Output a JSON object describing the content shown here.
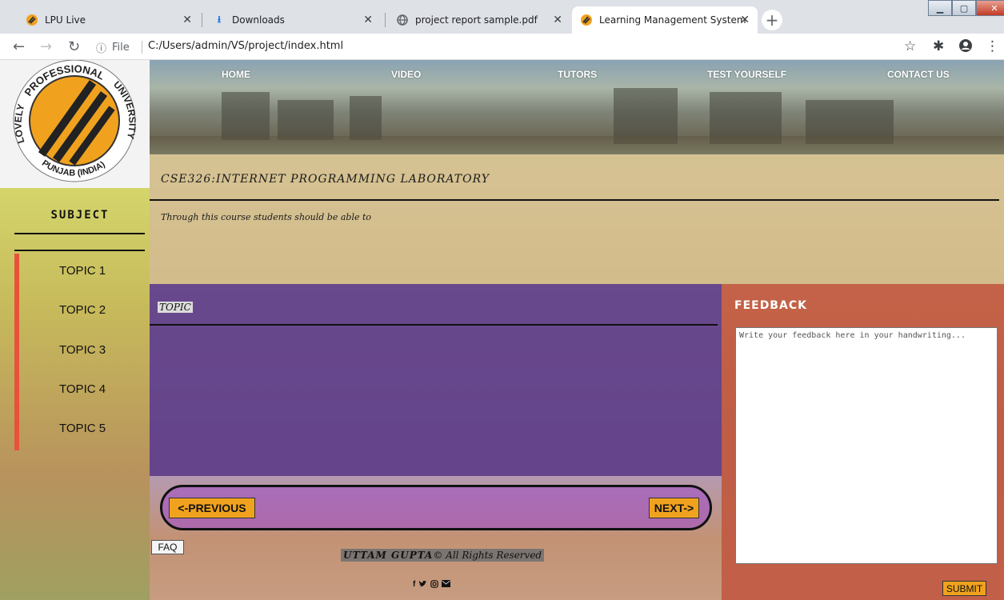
{
  "browser": {
    "tabs": [
      {
        "title": "LPU Live",
        "icon": "lpu-logo-icon"
      },
      {
        "title": "Downloads",
        "icon": "download-icon"
      },
      {
        "title": "project report sample.pdf",
        "icon": "globe-icon"
      },
      {
        "title": "Learning Management System",
        "icon": "lpu-logo-icon",
        "active": true
      }
    ],
    "address": {
      "info_label": "File",
      "url": "C:/Users/admin/VS/project/index.html"
    }
  },
  "nav": {
    "home": "HOME",
    "video": "VIDEO",
    "tutors": "TUTORS",
    "test": "TEST YOURSELF",
    "contact": "CONTACT US"
  },
  "logo": {
    "top_text": "PROFESSIONAL",
    "left_text": "LOVELY",
    "right_text": "UNIVERSITY",
    "bottom_text": "PUNJAB (INDIA)"
  },
  "sidebar": {
    "title": "SUBJECT",
    "topics": [
      "TOPIC 1",
      "TOPIC 2",
      "TOPIC 3",
      "TOPIC 4",
      "TOPIC 5"
    ]
  },
  "course": {
    "title": "CSE326:INTERNET PROGRAMMING LABORATORY",
    "subtitle": "Through this course students should be able to"
  },
  "topic_panel": {
    "label": "TOPIC"
  },
  "pager": {
    "previous": "<-PREVIOUS",
    "next": "NEXT->"
  },
  "footer": {
    "faq": "FAQ",
    "author": "UTTAM GUPTA",
    "copyright_symbol": "©",
    "rights": "All Rights Reserved",
    "social_icons": [
      "facebook-icon",
      "twitter-icon",
      "instagram-icon",
      "email-icon"
    ]
  },
  "feedback": {
    "title": "FEEDBACK",
    "placeholder": "Write your feedback here in your handwriting...",
    "submit": "SUBMIT"
  },
  "colors": {
    "accent_orange": "#f0a21e",
    "topic_purple": "#533896",
    "feedback_red": "#c25540",
    "topic_indicator": "#e8523b"
  }
}
